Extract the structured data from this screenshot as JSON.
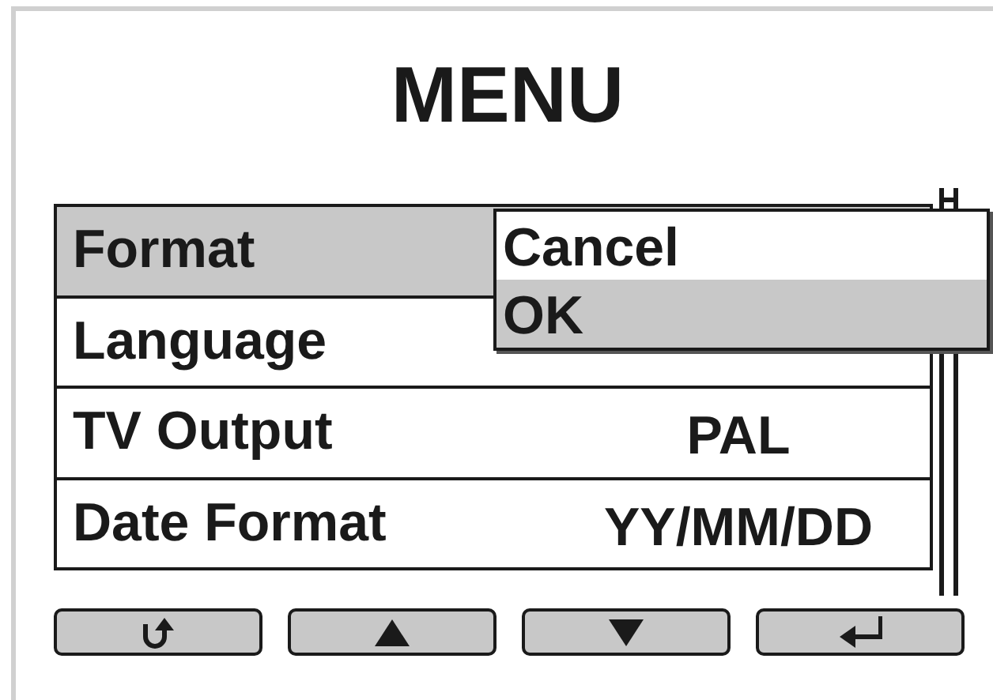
{
  "title": "MENU",
  "rows": [
    {
      "label": "Format",
      "selected": true
    },
    {
      "label": "Language",
      "selected": false
    },
    {
      "label": "TV Output",
      "value": "PAL",
      "selected": false
    },
    {
      "label": "Date Format",
      "value": "YY/MM/DD",
      "selected": false
    }
  ],
  "popup": {
    "options": [
      {
        "label": "Cancel",
        "selected": false
      },
      {
        "label": "OK",
        "selected": true
      }
    ]
  },
  "buttons": [
    {
      "kind": "back"
    },
    {
      "kind": "up"
    },
    {
      "kind": "down"
    },
    {
      "kind": "enter"
    }
  ]
}
